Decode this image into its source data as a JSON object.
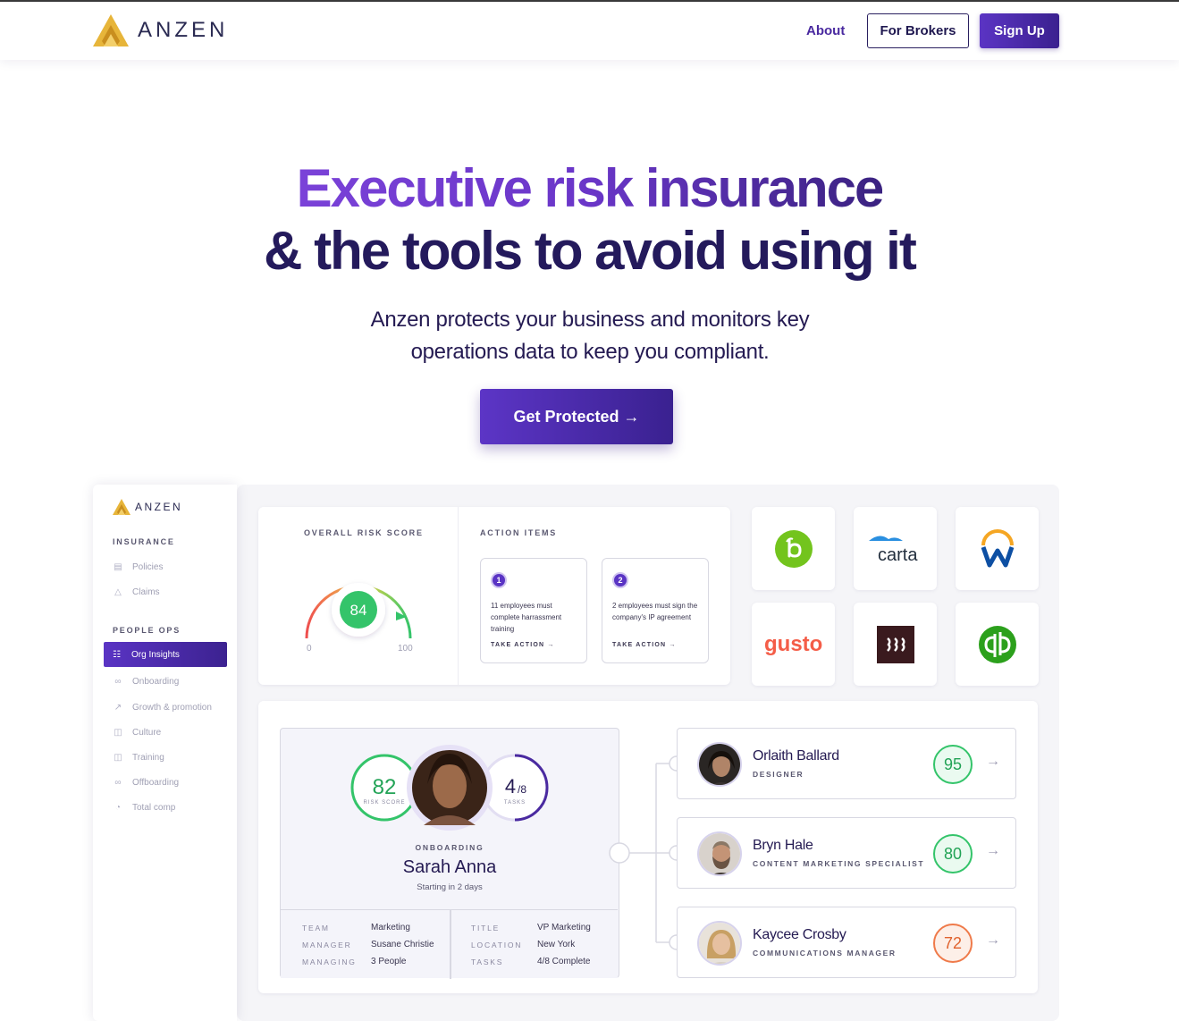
{
  "nav": {
    "brand": "ANZEN",
    "about": "About",
    "for_brokers": "For Brokers",
    "sign_up": "Sign Up"
  },
  "hero": {
    "line1": "Executive risk insurance",
    "line2": "& the tools to avoid using it",
    "subtitle": "Anzen protects your business and monitors key operations data to keep you compliant.",
    "cta": "Get Protected →"
  },
  "dashboard": {
    "sidebar": {
      "brand": "ANZEN",
      "section_insurance": "INSURANCE",
      "insurance_items": [
        {
          "label": "Policies",
          "icon": "document-icon"
        },
        {
          "label": "Claims",
          "icon": "warning-icon"
        }
      ],
      "section_people_ops": "PEOPLE OPS",
      "active_item": {
        "label": "Org Insights",
        "icon": "org-chart-icon"
      },
      "people_items": [
        {
          "label": "Onboarding",
          "icon": "link-icon"
        },
        {
          "label": "Growth & promotion",
          "icon": "trend-icon"
        },
        {
          "label": "Culture",
          "icon": "briefcase-icon"
        },
        {
          "label": "Training",
          "icon": "presentation-icon"
        },
        {
          "label": "Offboarding",
          "icon": "unlink-icon"
        },
        {
          "label": "Total comp",
          "icon": "pie-icon"
        }
      ]
    },
    "risk": {
      "label": "OVERALL RISK SCORE",
      "score": "84",
      "min": "0",
      "max": "100",
      "score_fraction": 0.84
    },
    "actions": {
      "label": "ACTION ITEMS",
      "items": [
        {
          "num": "1",
          "text": "11 employees must complete harrassment training",
          "cta": "TAKE ACTION →"
        },
        {
          "num": "2",
          "text": "2 employees must sign the company's IP agreement",
          "cta": "TAKE ACTION →"
        }
      ]
    },
    "integrations": [
      {
        "name": "bamboohr",
        "icon": "bamboohr-logo-icon"
      },
      {
        "name": "carta",
        "icon": "carta-logo-icon",
        "text": "carta"
      },
      {
        "name": "workday",
        "icon": "workday-logo-icon"
      },
      {
        "name": "gusto",
        "icon": "gusto-logo-icon",
        "text": "gusto"
      },
      {
        "name": "rippling",
        "icon": "rippling-logo-icon"
      },
      {
        "name": "quickbooks",
        "icon": "quickbooks-logo-icon"
      }
    ],
    "profile": {
      "risk_score": "82",
      "risk_label": "RISK SCORE",
      "tasks_done": "4",
      "tasks_total": "/8",
      "tasks_label": "TASKS",
      "status": "ONBOARDING",
      "name": "Sarah Anna",
      "start": "Starting in 2 days",
      "details": {
        "team_key": "TEAM",
        "team": "Marketing",
        "manager_key": "MANAGER",
        "manager": "Susane Christie",
        "managing_key": "MANAGING",
        "managing": "3 People",
        "title_key": "TITLE",
        "title": "VP Marketing",
        "location_key": "LOCATION",
        "location": "New York",
        "tasks_key": "TASKS",
        "tasks": "4/8 Complete"
      }
    },
    "reports": [
      {
        "name": "Orlaith Ballard",
        "role": "DESIGNER",
        "score": "95",
        "status_color": "#34c46a"
      },
      {
        "name": "Bryn Hale",
        "role": "CONTENT MARKETING SPECIALIST",
        "score": "80",
        "status_color": "#34c46a"
      },
      {
        "name": "Kaycee Crosby",
        "role": "COMMUNICATIONS MANAGER",
        "score": "72",
        "status_color": "#ef7a4a"
      }
    ]
  },
  "colors": {
    "brand_purple": "#5b34c4",
    "brand_dark": "#241a52",
    "logo_gold": "#e2a92c"
  }
}
